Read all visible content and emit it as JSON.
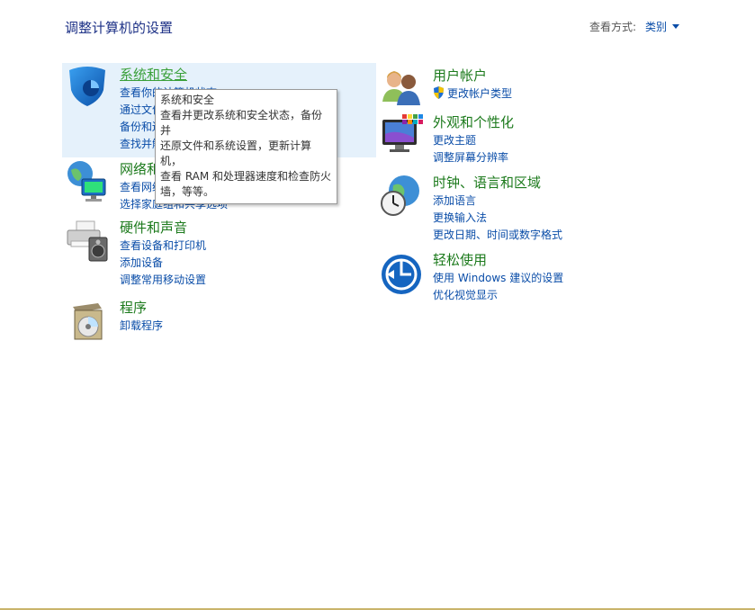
{
  "header": {
    "title": "调整计算机的设置",
    "view_by_label": "查看方式:",
    "view_by_value": "类别"
  },
  "categories": [
    {
      "title": "系统和安全",
      "icon": "shield-icon",
      "links": [
        "查看你的计算机状态",
        "通过文件历史记录保存你的文件备份副本",
        "备份和还原(Windows 7)",
        "查找并解决问题"
      ]
    },
    {
      "title": "网络和 Internet",
      "icon": "network-globe-icon",
      "links": [
        "查看网络状态和任务",
        "选择家庭组和共享选项"
      ]
    },
    {
      "title": "硬件和声音",
      "icon": "printer-speaker-icon",
      "links": [
        "查看设备和打印机",
        "添加设备",
        "调整常用移动设置"
      ]
    },
    {
      "title": "程序",
      "icon": "programs-disc-icon",
      "links": [
        "卸载程序"
      ]
    },
    {
      "title": "用户帐户",
      "icon": "users-icon",
      "links": [
        "更改帐户类型"
      ]
    },
    {
      "title": "外观和个性化",
      "icon": "monitor-palette-icon",
      "links": [
        "更改主题",
        "调整屏幕分辨率"
      ]
    },
    {
      "title": "时钟、语言和区域",
      "icon": "clock-globe-icon",
      "links": [
        "添加语言",
        "更换输入法",
        "更改日期、时间或数字格式"
      ]
    },
    {
      "title": "轻松使用",
      "icon": "ease-of-access-icon",
      "links": [
        "使用 Windows 建议的设置",
        "优化视觉显示"
      ]
    }
  ],
  "tooltip": {
    "lines": [
      "系统和安全",
      "查看并更改系统和安全状态，备份并",
      "还原文件和系统设置，更新计算机，",
      "查看 RAM 和处理器速度和检查防火",
      "墙，等等。"
    ]
  },
  "colors": {
    "category_title": "#1c7a1c",
    "link": "#0a4da8",
    "hover_background": "#e5f1fb",
    "page_title": "#1e3287"
  }
}
